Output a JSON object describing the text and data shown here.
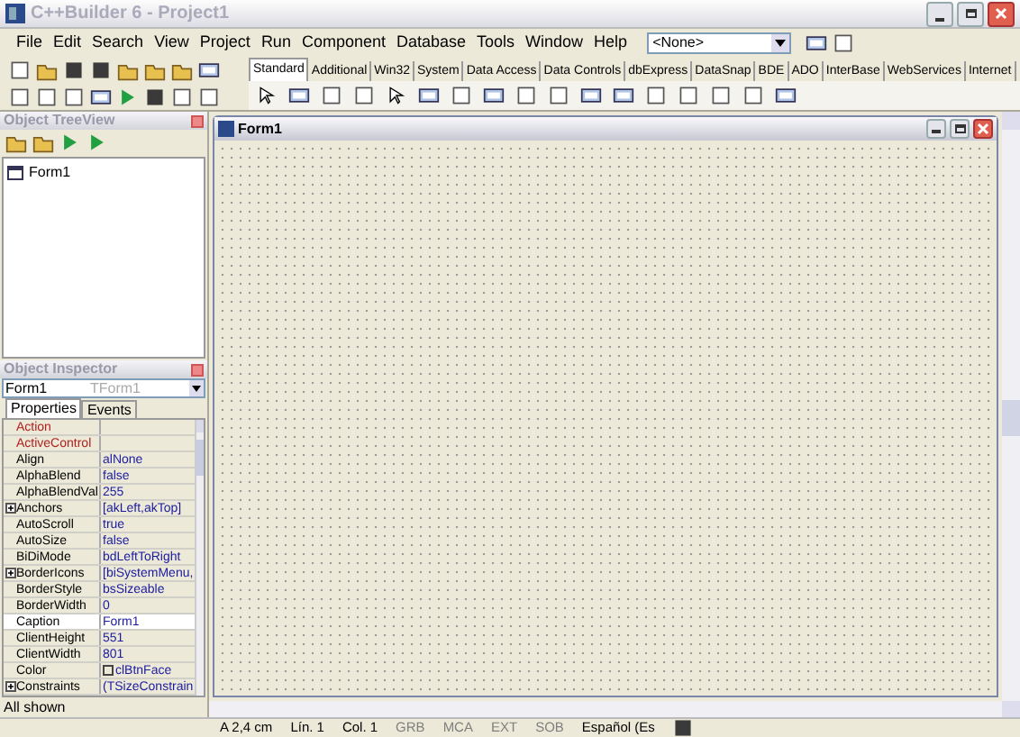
{
  "window": {
    "title": "C++Builder 6 - Project1"
  },
  "menu": [
    "File",
    "Edit",
    "Search",
    "View",
    "Project",
    "Run",
    "Component",
    "Database",
    "Tools",
    "Window",
    "Help"
  ],
  "config_combo": {
    "value": "<None>"
  },
  "palette_tabs": [
    {
      "label": "Standard",
      "selected": true
    },
    {
      "label": "Additional",
      "selected": false
    },
    {
      "label": "Win32",
      "selected": false
    },
    {
      "label": "System",
      "selected": false
    },
    {
      "label": "Data Access",
      "selected": false
    },
    {
      "label": "Data Controls",
      "selected": false
    },
    {
      "label": "dbExpress",
      "selected": false
    },
    {
      "label": "DataSnap",
      "selected": false
    },
    {
      "label": "BDE",
      "selected": false
    },
    {
      "label": "ADO",
      "selected": false
    },
    {
      "label": "InterBase",
      "selected": false
    },
    {
      "label": "WebServices",
      "selected": false
    },
    {
      "label": "Internet",
      "selected": false
    }
  ],
  "tree_view": {
    "title": "Object TreeView",
    "items": [
      {
        "label": "Form1"
      }
    ]
  },
  "inspector": {
    "title": "Object Inspector",
    "object_name": "Form1",
    "object_type": "TForm1",
    "tabs": [
      {
        "label": "Properties",
        "selected": true
      },
      {
        "label": "Events",
        "selected": false
      }
    ],
    "rows": [
      {
        "name": "Action",
        "value": "",
        "kind": "linked",
        "selected": false
      },
      {
        "name": "ActiveControl",
        "value": "",
        "kind": "linked",
        "selected": false
      },
      {
        "name": "Align",
        "value": "alNone",
        "kind": "plain",
        "selected": false
      },
      {
        "name": "AlphaBlend",
        "value": "false",
        "kind": "plain",
        "selected": false
      },
      {
        "name": "AlphaBlendVal",
        "value": "255",
        "kind": "plain",
        "selected": false
      },
      {
        "name": "Anchors",
        "value": "[akLeft,akTop]",
        "kind": "set",
        "selected": false
      },
      {
        "name": "AutoScroll",
        "value": "true",
        "kind": "plain",
        "selected": false
      },
      {
        "name": "AutoSize",
        "value": "false",
        "kind": "plain",
        "selected": false
      },
      {
        "name": "BiDiMode",
        "value": "bdLeftToRight",
        "kind": "plain",
        "selected": false
      },
      {
        "name": "BorderIcons",
        "value": "[biSystemMenu,",
        "kind": "set",
        "selected": false
      },
      {
        "name": "BorderStyle",
        "value": "bsSizeable",
        "kind": "plain",
        "selected": false
      },
      {
        "name": "BorderWidth",
        "value": "0",
        "kind": "plain",
        "selected": false
      },
      {
        "name": "Caption",
        "value": "Form1",
        "kind": "plain",
        "selected": true
      },
      {
        "name": "ClientHeight",
        "value": "551",
        "kind": "plain",
        "selected": false
      },
      {
        "name": "ClientWidth",
        "value": "801",
        "kind": "plain",
        "selected": false
      },
      {
        "name": "Color",
        "value": "clBtnFace",
        "kind": "color",
        "selected": false
      },
      {
        "name": "Constraints",
        "value": "(TSizeConstrain",
        "kind": "set",
        "selected": false
      }
    ],
    "footer": "All shown"
  },
  "form": {
    "title": "Form1"
  },
  "status_bar": [
    "A 2,4 cm",
    "Lín. 1",
    "Col. 1",
    "GRB",
    "MCA",
    "EXT",
    "SOB",
    "Español (Es"
  ]
}
